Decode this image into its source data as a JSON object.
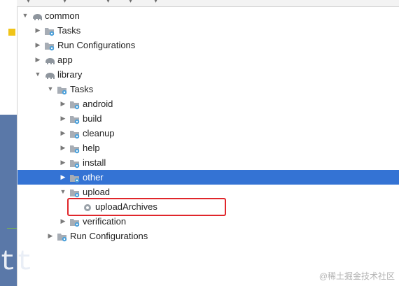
{
  "tree": [
    {
      "label": "common",
      "icon": "gradle-elephant-icon",
      "depth": 0,
      "arrow": "expanded",
      "selected": false
    },
    {
      "label": "Tasks",
      "icon": "folder-gear-icon",
      "depth": 1,
      "arrow": "collapsed",
      "selected": false
    },
    {
      "label": "Run Configurations",
      "icon": "folder-gear-icon",
      "depth": 1,
      "arrow": "collapsed",
      "selected": false
    },
    {
      "label": "app",
      "icon": "gradle-elephant-icon",
      "depth": 1,
      "arrow": "collapsed",
      "selected": false
    },
    {
      "label": "library",
      "icon": "gradle-elephant-icon",
      "depth": 1,
      "arrow": "expanded",
      "selected": false
    },
    {
      "label": "Tasks",
      "icon": "folder-gear-icon",
      "depth": 2,
      "arrow": "expanded",
      "selected": false
    },
    {
      "label": "android",
      "icon": "folder-gear-icon",
      "depth": 3,
      "arrow": "collapsed",
      "selected": false
    },
    {
      "label": "build",
      "icon": "folder-gear-icon",
      "depth": 3,
      "arrow": "collapsed",
      "selected": false
    },
    {
      "label": "cleanup",
      "icon": "folder-gear-icon",
      "depth": 3,
      "arrow": "collapsed",
      "selected": false
    },
    {
      "label": "help",
      "icon": "folder-gear-icon",
      "depth": 3,
      "arrow": "collapsed",
      "selected": false
    },
    {
      "label": "install",
      "icon": "folder-gear-icon",
      "depth": 3,
      "arrow": "collapsed",
      "selected": false
    },
    {
      "label": "other",
      "icon": "folder-gear-icon",
      "depth": 3,
      "arrow": "collapsed",
      "selected": true
    },
    {
      "label": "upload",
      "icon": "folder-gear-icon",
      "depth": 3,
      "arrow": "expanded",
      "selected": false
    },
    {
      "label": "uploadArchives",
      "icon": "gear-icon",
      "depth": 4,
      "arrow": "none",
      "selected": false
    },
    {
      "label": "verification",
      "icon": "folder-gear-icon",
      "depth": 3,
      "arrow": "collapsed",
      "selected": false
    },
    {
      "label": "Run Configurations",
      "icon": "folder-gear-icon",
      "depth": 2,
      "arrow": "collapsed",
      "selected": false
    }
  ],
  "left_glyph": "tt",
  "watermark": "@稀土掘金技术社区",
  "colors": {
    "selection": "#3473d4",
    "highlight_box": "#e0262b",
    "folder": "#a7adb5",
    "gear": "#4aa0db"
  }
}
